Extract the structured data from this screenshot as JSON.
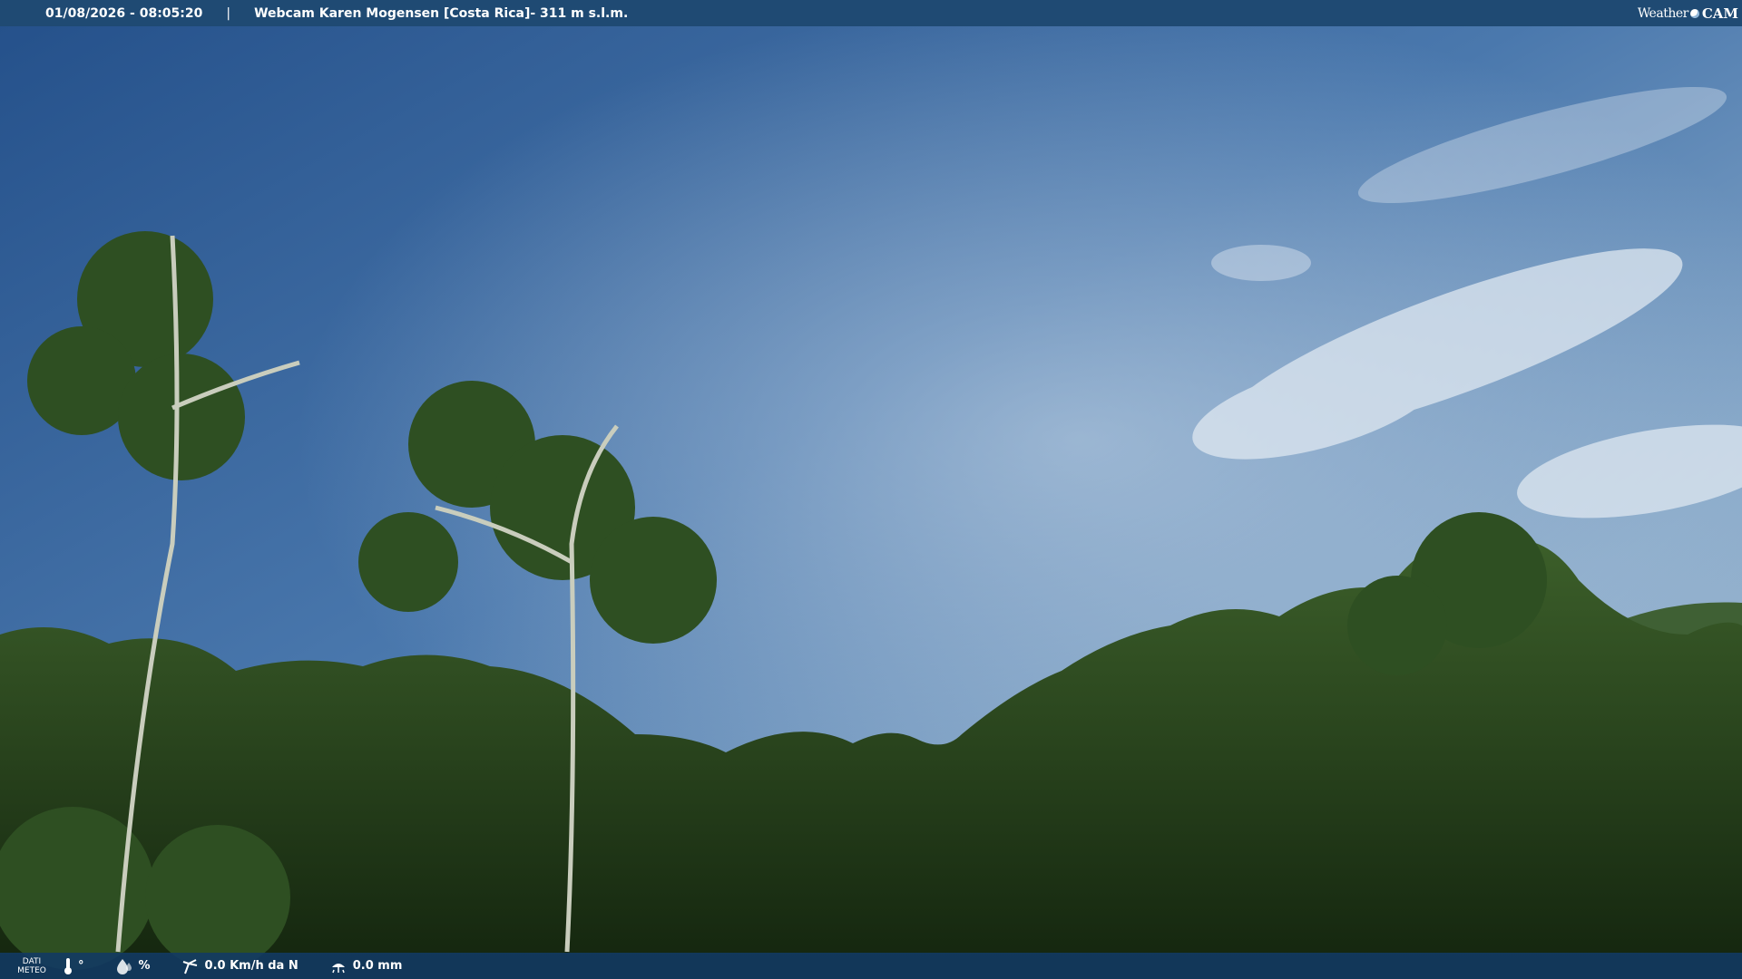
{
  "header": {
    "datetime": "01/08/2026 - 08:05:20",
    "separator": "|",
    "webcam_title": "Webcam Karen Mogensen [Costa Rica]",
    "altitude": " - 311 m s.l.m."
  },
  "logo": {
    "text_weather": "Weather",
    "text_cam": "CAM",
    "icon": "weather-sun-icon"
  },
  "footer": {
    "dati_line1": "DATI",
    "dati_line2": "METEO",
    "temperature": "°",
    "humidity": "%",
    "wind": "0.0 Km/h da N",
    "rain": "0.0 mm",
    "icons": [
      "thermometer-icon",
      "humidity-icon",
      "wind-icon",
      "rain-gauge-icon"
    ]
  },
  "colors": {
    "sky_top": "#2b5687",
    "sky_bottom": "#8fb0cf",
    "foliage": "#1f3a1a",
    "bar": "#1f4a73"
  }
}
